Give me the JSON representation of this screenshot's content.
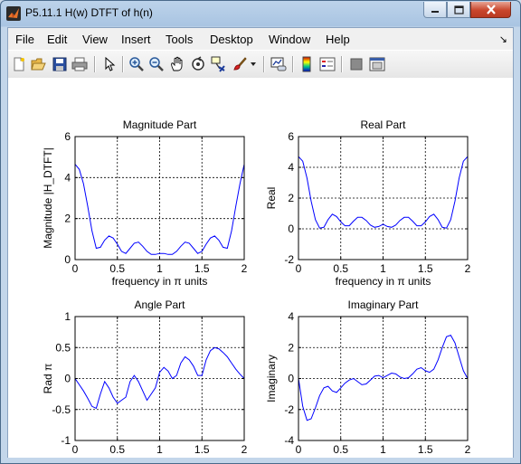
{
  "window": {
    "title": "P5.11.1 H(w) DTFT of h(n)"
  },
  "menu": {
    "items": [
      "File",
      "Edit",
      "View",
      "Insert",
      "Tools",
      "Desktop",
      "Window",
      "Help"
    ]
  },
  "toolbar": {
    "icons": [
      "new-figure-icon",
      "open-file-icon",
      "save-icon",
      "print-icon",
      "pointer-icon",
      "zoom-in-icon",
      "zoom-out-icon",
      "pan-icon",
      "rotate-icon",
      "data-cursor-icon",
      "brush-icon",
      "brush-dropdown-icon",
      "link-plot-icon",
      "colorbar-icon",
      "legend-icon",
      "hide-plot-tools-icon",
      "show-plot-tools-icon"
    ]
  },
  "colors": {
    "line": "#0000ff",
    "axes": "#000000",
    "figure_bg": "#ffffff"
  },
  "chart_data": [
    {
      "type": "line",
      "title": "Magnitude Part",
      "xlabel": "frequency in π units",
      "ylabel": "Magnitude  |H_DTFT|",
      "xlim": [
        0,
        2
      ],
      "ylim": [
        0,
        6
      ],
      "xticks": [
        "0",
        "0.5",
        "1",
        "1.5",
        "2"
      ],
      "yticks": [
        "0",
        "2",
        "4",
        "6"
      ],
      "grid": true,
      "x": [
        0,
        0.05,
        0.1,
        0.15,
        0.2,
        0.25,
        0.3,
        0.35,
        0.4,
        0.45,
        0.5,
        0.55,
        0.6,
        0.65,
        0.7,
        0.75,
        0.8,
        0.85,
        0.9,
        0.95,
        1,
        1.05,
        1.1,
        1.15,
        1.2,
        1.25,
        1.3,
        1.35,
        1.4,
        1.45,
        1.5,
        1.55,
        1.6,
        1.65,
        1.7,
        1.75,
        1.8,
        1.85,
        1.9,
        1.95,
        2
      ],
      "y": [
        4.65,
        4.4,
        3.7,
        2.6,
        1.4,
        0.55,
        0.6,
        0.95,
        1.15,
        1.05,
        0.75,
        0.4,
        0.3,
        0.55,
        0.8,
        0.85,
        0.65,
        0.4,
        0.25,
        0.25,
        0.3,
        0.3,
        0.25,
        0.25,
        0.4,
        0.65,
        0.85,
        0.8,
        0.55,
        0.3,
        0.4,
        0.75,
        1.05,
        1.15,
        0.95,
        0.6,
        0.55,
        1.4,
        2.6,
        3.7,
        4.65
      ]
    },
    {
      "type": "line",
      "title": "Real Part",
      "xlabel": "frequency in π units",
      "ylabel": "Real",
      "xlim": [
        0,
        2
      ],
      "ylim": [
        -2,
        6
      ],
      "xticks": [
        "0",
        "0.5",
        "1",
        "1.5",
        "2"
      ],
      "yticks": [
        "-2",
        "0",
        "2",
        "4",
        "6"
      ],
      "grid": true,
      "x": [
        0,
        0.05,
        0.1,
        0.15,
        0.2,
        0.25,
        0.3,
        0.35,
        0.4,
        0.45,
        0.5,
        0.55,
        0.6,
        0.65,
        0.7,
        0.75,
        0.8,
        0.85,
        0.9,
        0.95,
        1,
        1.05,
        1.1,
        1.15,
        1.2,
        1.25,
        1.3,
        1.35,
        1.4,
        1.45,
        1.5,
        1.55,
        1.6,
        1.65,
        1.7,
        1.75,
        1.8,
        1.85,
        1.9,
        1.95,
        2
      ],
      "y": [
        4.7,
        4.4,
        3.3,
        1.8,
        0.6,
        0.05,
        0.1,
        0.6,
        0.95,
        0.8,
        0.45,
        0.2,
        0.2,
        0.5,
        0.75,
        0.75,
        0.55,
        0.25,
        0.1,
        0.15,
        0.3,
        0.15,
        0.1,
        0.25,
        0.55,
        0.75,
        0.75,
        0.5,
        0.2,
        0.2,
        0.45,
        0.8,
        0.95,
        0.6,
        0.1,
        0.05,
        0.6,
        1.8,
        3.3,
        4.4,
        4.7
      ]
    },
    {
      "type": "line",
      "title": "Angle Part",
      "xlabel": "frequency in π units",
      "ylabel": "Rad π",
      "xlim": [
        0,
        2
      ],
      "ylim": [
        -1,
        1
      ],
      "xticks": [
        "0",
        "0.5",
        "1",
        "1.5",
        "2"
      ],
      "yticks": [
        "-1",
        "-0.5",
        "0",
        "0.5",
        "1"
      ],
      "grid": true,
      "x": [
        0,
        0.05,
        0.1,
        0.15,
        0.2,
        0.25,
        0.3,
        0.35,
        0.4,
        0.45,
        0.5,
        0.55,
        0.6,
        0.65,
        0.7,
        0.75,
        0.8,
        0.85,
        0.9,
        0.95,
        1,
        1.05,
        1.1,
        1.15,
        1.2,
        1.25,
        1.3,
        1.35,
        1.4,
        1.45,
        1.5,
        1.55,
        1.6,
        1.65,
        1.7,
        1.75,
        1.8,
        1.85,
        1.9,
        1.95,
        2
      ],
      "y": [
        0,
        -0.1,
        -0.2,
        -0.32,
        -0.45,
        -0.48,
        -0.25,
        -0.05,
        -0.15,
        -0.3,
        -0.4,
        -0.35,
        -0.3,
        -0.05,
        0.05,
        -0.05,
        -0.2,
        -0.35,
        -0.25,
        -0.15,
        0.1,
        0.18,
        0.12,
        0.0,
        0.05,
        0.25,
        0.35,
        0.3,
        0.2,
        0.05,
        0.05,
        0.3,
        0.45,
        0.5,
        0.48,
        0.42,
        0.35,
        0.25,
        0.15,
        0.07,
        0
      ]
    },
    {
      "type": "line",
      "title": "Imaginary Part",
      "xlabel": "frequency in π units",
      "ylabel": "Imaginary",
      "xlim": [
        0,
        2
      ],
      "ylim": [
        -4,
        4
      ],
      "xticks": [
        "0",
        "0.5",
        "1",
        "1.5",
        "2"
      ],
      "yticks": [
        "-4",
        "-2",
        "0",
        "2",
        "4"
      ],
      "grid": true,
      "x": [
        0,
        0.05,
        0.1,
        0.15,
        0.2,
        0.25,
        0.3,
        0.35,
        0.4,
        0.45,
        0.5,
        0.55,
        0.6,
        0.65,
        0.7,
        0.75,
        0.8,
        0.85,
        0.9,
        0.95,
        1,
        1.05,
        1.1,
        1.15,
        1.2,
        1.25,
        1.3,
        1.35,
        1.4,
        1.45,
        1.5,
        1.55,
        1.6,
        1.65,
        1.7,
        1.75,
        1.8,
        1.85,
        1.9,
        1.95,
        2
      ],
      "y": [
        0,
        -1.8,
        -2.7,
        -2.6,
        -1.9,
        -1.1,
        -0.6,
        -0.5,
        -0.8,
        -0.9,
        -0.6,
        -0.3,
        -0.1,
        0.0,
        -0.2,
        -0.4,
        -0.35,
        -0.1,
        0.15,
        0.2,
        0.05,
        0.2,
        0.35,
        0.3,
        0.1,
        0.0,
        0.05,
        0.3,
        0.6,
        0.7,
        0.5,
        0.4,
        0.6,
        1.2,
        2.0,
        2.7,
        2.8,
        2.3,
        1.4,
        0.5,
        0
      ]
    }
  ]
}
